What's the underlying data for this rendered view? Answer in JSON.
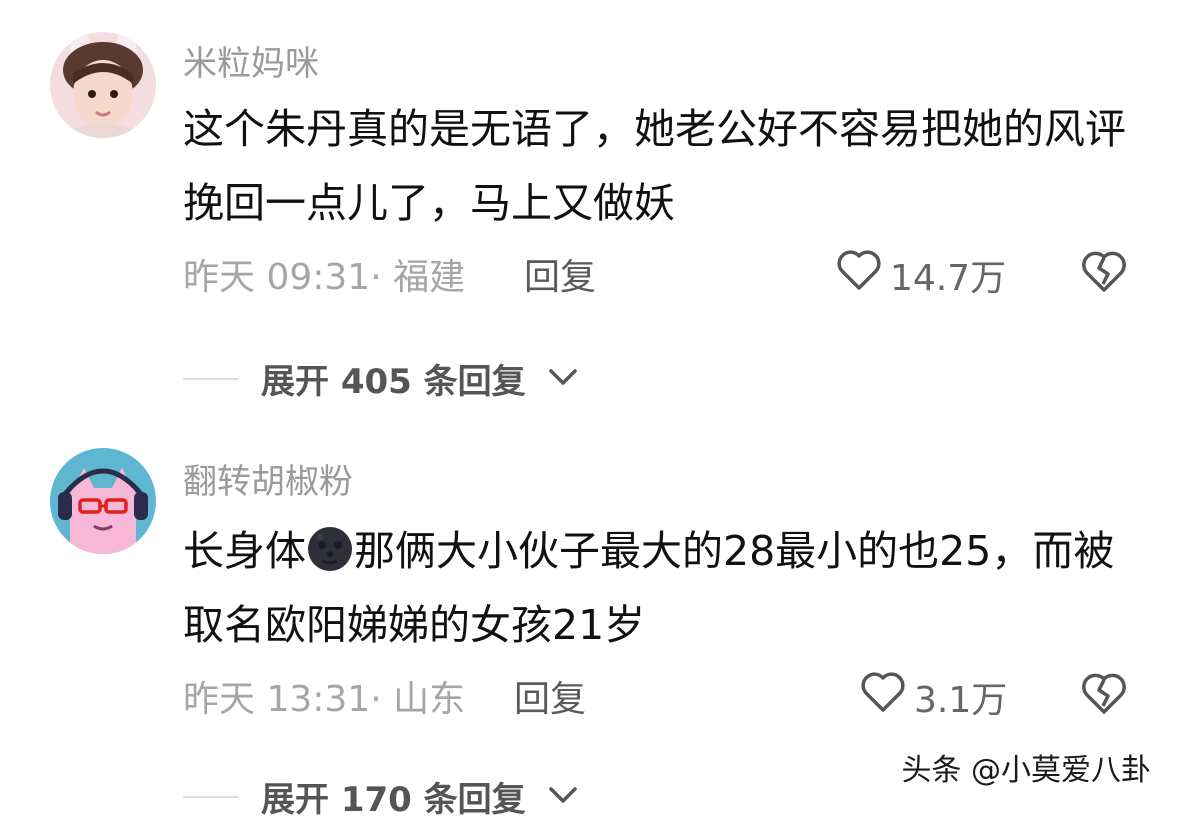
{
  "comments": [
    {
      "username": "米粒妈咪",
      "text": "这个朱丹真的是无语了，她老公好不容易把她的风评挽回一点儿了，马上又做妖",
      "meta": "昨天 09:31· 福建",
      "reply_label": "回复",
      "likes": "14.7万",
      "expand_label": "展开 405 条回复"
    },
    {
      "username": "翻转胡椒粉",
      "text_before_emoji": "长身体",
      "emoji": "new-moon-face",
      "text_after_emoji": "那俩大小伙子最大的28最小的也25，而被取名欧阳娣娣的女孩21岁",
      "meta": "昨天 13:31· 山东",
      "reply_label": "回复",
      "likes": "3.1万",
      "expand_label": "展开 170 条回复"
    }
  ],
  "watermark": "头条 @小莫爱八卦",
  "colors": {
    "text": "#111111",
    "username": "#9a9a9a",
    "meta": "#a6a6a6",
    "expand": "#555555"
  }
}
